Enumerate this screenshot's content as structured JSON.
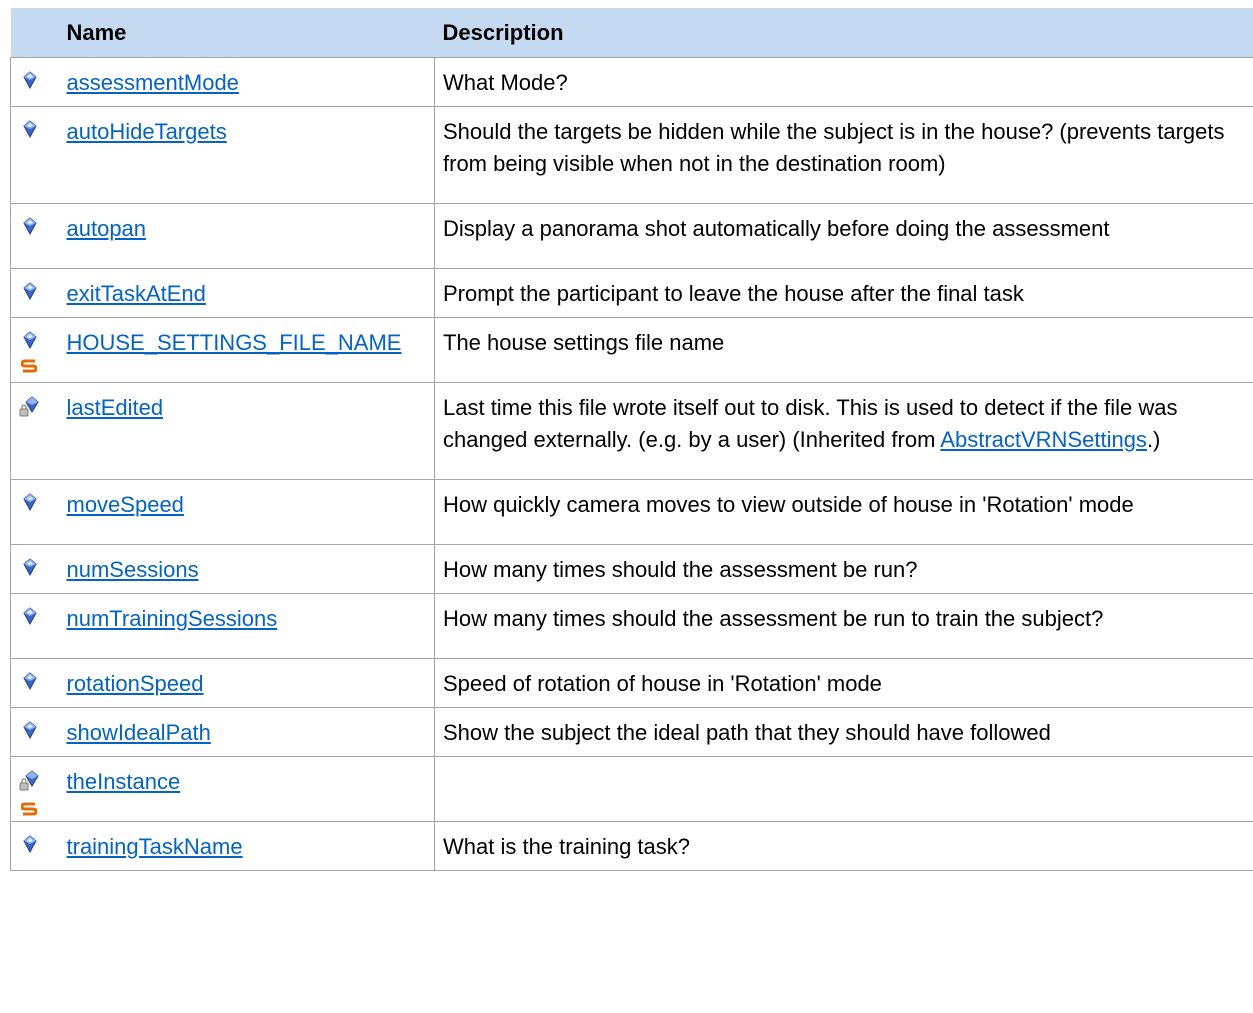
{
  "header": {
    "name": "Name",
    "description": "Description"
  },
  "rows": [
    {
      "name": "assessmentMode",
      "description": "What Mode?",
      "icon": "public-field-icon",
      "static": false
    },
    {
      "name": "autoHideTargets",
      "description": "Should the targets be hidden while the subject is in the house? (prevents targets from being visible when not in the destination room)",
      "icon": "public-field-icon",
      "static": false
    },
    {
      "name": "autopan",
      "description": "Display a panorama shot automatically before doing the assessment",
      "icon": "public-field-icon",
      "static": false
    },
    {
      "name": "exitTaskAtEnd",
      "description": "Prompt the participant to leave the house after the final task",
      "icon": "public-field-icon",
      "static": false
    },
    {
      "name": "HOUSE_SETTINGS_FILE_NAME",
      "description": "The house settings file name",
      "icon": "public-field-icon",
      "static": true
    },
    {
      "name": "lastEdited",
      "description_before": "Last time this file wrote itself out to disk. This is used to detect if the file was changed externally. (e.g. by a user) (Inherited from ",
      "description_link": "AbstractVRNSettings",
      "description_after": ".)",
      "icon": "protected-field-icon",
      "static": false
    },
    {
      "name": "moveSpeed",
      "description": "How quickly camera moves to view outside of house in 'Rotation' mode",
      "icon": "public-field-icon",
      "static": false
    },
    {
      "name": "numSessions",
      "description": "How many times should the assessment be run?",
      "icon": "public-field-icon",
      "static": false
    },
    {
      "name": "numTrainingSessions",
      "description": "How many times should the assessment be run to train the subject?",
      "icon": "public-field-icon",
      "static": false
    },
    {
      "name": "rotationSpeed",
      "description": "Speed of rotation of house in 'Rotation' mode",
      "icon": "public-field-icon",
      "static": false
    },
    {
      "name": "showIdealPath",
      "description": "Show the subject the ideal path that they should have followed",
      "icon": "public-field-icon",
      "static": false
    },
    {
      "name": "theInstance",
      "description": "",
      "icon": "protected-field-icon",
      "static": true
    },
    {
      "name": "trainingTaskName",
      "description": "What is the training task?",
      "icon": "public-field-icon",
      "static": false
    }
  ],
  "colors": {
    "header_bg": "#c5d9f1",
    "link": "#0563c1",
    "border": "#a6a6a6",
    "static_icon": "#e36c09"
  }
}
